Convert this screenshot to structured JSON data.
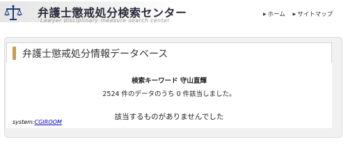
{
  "header": {
    "site_title": "弁護士懲戒処分検索センター",
    "site_subtitle": "Lawyer disciplinary measure search center",
    "nav": [
      {
        "label": "ホーム"
      },
      {
        "label": "サイトマップ"
      }
    ],
    "logo_icon": "scales-of-justice-icon"
  },
  "main": {
    "page_title": "弁護士懲戒処分情報データベース",
    "search_keyword": "検索キーワード 守山直輝",
    "result_count": "2524 件のデータのうち 0 件該当しました。",
    "no_result_message": "該当するものがありませんでした"
  },
  "footer": {
    "system_label": "system:",
    "system_link": "CGIROOM"
  },
  "colors": {
    "accent": "#c9a04a",
    "link": "#0000cc",
    "logo": "#1f3a7a"
  }
}
